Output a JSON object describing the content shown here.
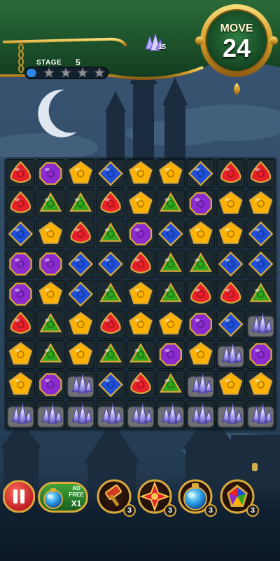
{
  "hud": {
    "stage_label": "STAGE",
    "stage_number": "5",
    "stage_stars_earned": 0,
    "stage_stars_total": 4,
    "stage_progress": 0.12,
    "crystal_goal_count": "15",
    "move_label": "MOVE",
    "move_count": "24"
  },
  "board": {
    "columns": 9,
    "rows": 9,
    "legend": {
      "R": "red-gem",
      "P": "purple-gem",
      "Y": "yellow-gem",
      "B": "blue-gem",
      "G": "green-gem",
      "C": "crystal-rock",
      "_": "empty-cell"
    },
    "grid": [
      [
        "R",
        "P",
        "Y",
        "B",
        "Y",
        "Y",
        "B",
        "R",
        "R"
      ],
      [
        "R",
        "G",
        "G",
        "R",
        "Y",
        "G",
        "P",
        "Y",
        "Y"
      ],
      [
        "B",
        "Y",
        "R",
        "G",
        "P",
        "B",
        "Y",
        "Y",
        "B"
      ],
      [
        "P",
        "P",
        "B",
        "B",
        "R",
        "G",
        "G",
        "B",
        "B"
      ],
      [
        "P",
        "Y",
        "B",
        "G",
        "Y",
        "G",
        "R",
        "R",
        "G"
      ],
      [
        "R",
        "G",
        "Y",
        "R",
        "Y",
        "Y",
        "P",
        "B",
        "C"
      ],
      [
        "Y",
        "G",
        "Y",
        "G",
        "G",
        "P",
        "Y",
        "C",
        "P"
      ],
      [
        "Y",
        "P",
        "C",
        "B",
        "R",
        "G",
        "C",
        "Y",
        "Y"
      ],
      [
        "C",
        "C",
        "C",
        "C",
        "C",
        "C",
        "C",
        "C",
        "C"
      ]
    ]
  },
  "bottom_bar": {
    "ad_free_line1": "AD",
    "ad_free_line2": "FREE",
    "ad_free_multiplier": "X1",
    "boosters": [
      {
        "name": "hammer-booster",
        "icon": "hammer-icon",
        "count": "3"
      },
      {
        "name": "cross-blast-booster",
        "icon": "cross-blast-icon",
        "count": "3"
      },
      {
        "name": "potion-booster",
        "icon": "potion-icon",
        "count": "3"
      },
      {
        "name": "rainbow-gem-booster",
        "icon": "rainbow-gem-icon",
        "count": "3"
      }
    ]
  },
  "colors": {
    "gold_frame": "#d9a93a",
    "hud_green": "#1f5a2e",
    "cell_bg": "#1c2a30",
    "red": "#e8202a",
    "purple": "#8a2bd0",
    "yellow": "#ffb300",
    "blue": "#1f4fd8",
    "green": "#2ea51c"
  }
}
